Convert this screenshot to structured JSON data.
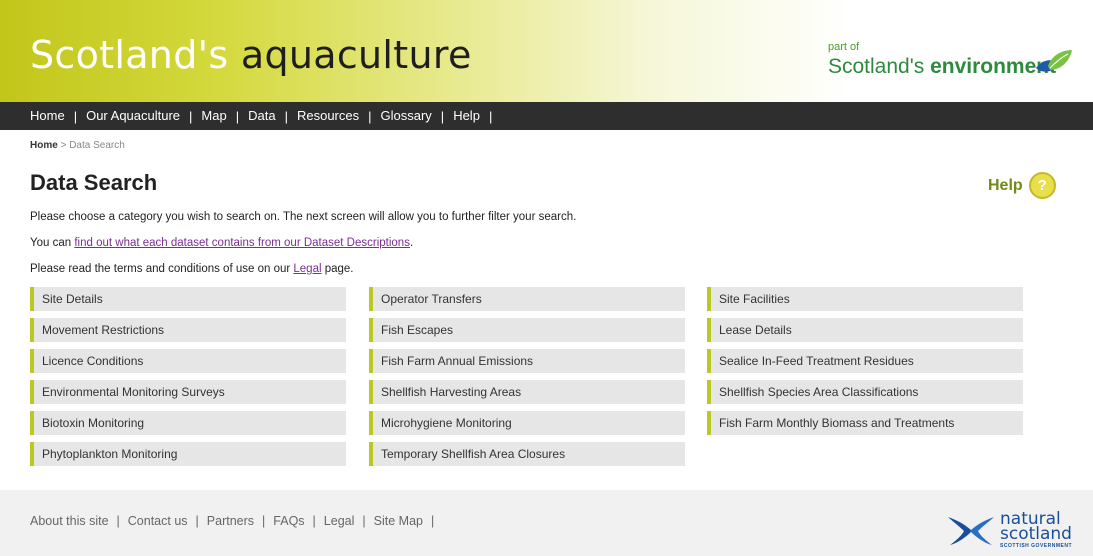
{
  "header": {
    "title_part1": "Scotland's",
    "title_part2": "aquaculture",
    "partner_prefix": "part of",
    "partner_name_regular": "Scotland's",
    "partner_name_bold": "environment",
    "brand_color": "#c2c61a"
  },
  "nav": {
    "items": [
      "Home",
      "Our Aquaculture",
      "Map",
      "Data",
      "Resources",
      "Glossary",
      "Help"
    ],
    "separator": "|"
  },
  "breadcrumb": {
    "home": "Home",
    "sep": ">",
    "current": "Data Search"
  },
  "page": {
    "title": "Data Search",
    "help_label": "Help",
    "help_icon_glyph": "?",
    "intro1": "Please choose a category you wish to search on. The next screen will allow you to further filter your search.",
    "intro2_prefix": "You can ",
    "intro2_link": "find out what each dataset contains from our Dataset Descriptions",
    "intro2_suffix": ".",
    "intro3_prefix": "Please read the terms and conditions of use on our ",
    "intro3_link": "Legal",
    "intro3_suffix": " page."
  },
  "categories": {
    "col1": [
      "Site Details",
      "Movement Restrictions",
      "Licence Conditions",
      "Environmental Monitoring Surveys",
      "Biotoxin Monitoring",
      "Phytoplankton Monitoring"
    ],
    "col2": [
      "Operator Transfers",
      "Fish Escapes",
      "Fish Farm Annual Emissions",
      "Shellfish Harvesting Areas",
      "Microhygiene Monitoring",
      "Temporary Shellfish Area Closures"
    ],
    "col3": [
      "Site Facilities",
      "Lease Details",
      "Sealice In-Feed Treatment Residues",
      "Shellfish Species Area Classifications",
      "Fish Farm Monthly Biomass and Treatments"
    ]
  },
  "footer": {
    "links": [
      "About this site",
      "Contact us",
      "Partners",
      "FAQs",
      "Legal",
      "Site Map"
    ],
    "separator": "|",
    "logo_line1": "natural",
    "logo_line2": "scotland",
    "logo_line3": "SCOTTISH GOVERNMENT"
  }
}
